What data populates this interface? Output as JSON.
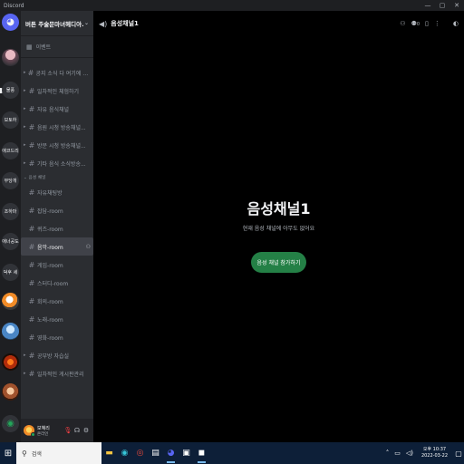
{
  "window": {
    "title": "Discord",
    "controls": {
      "minimize": "—",
      "maximize": "▢",
      "close": "✕"
    }
  },
  "servers": [
    {
      "type": "home",
      "icon": "discord-logo-icon"
    },
    {
      "type": "avatar",
      "label": ""
    },
    {
      "type": "text",
      "label": "물풍"
    },
    {
      "type": "text",
      "label": "보토하"
    },
    {
      "type": "text",
      "label": "애코드리"
    },
    {
      "type": "text",
      "label": "무당개"
    },
    {
      "type": "text",
      "label": "조하마"
    },
    {
      "type": "text",
      "label": "애너공도"
    },
    {
      "type": "text",
      "label": "덕후 세"
    },
    {
      "type": "avatar",
      "label": ""
    },
    {
      "type": "avatar",
      "label": ""
    },
    {
      "type": "avatar",
      "label": ""
    },
    {
      "type": "avatar",
      "label": ""
    },
    {
      "type": "discover",
      "icon": "compass-icon"
    }
  ],
  "guild": {
    "name": "버튼 주술문마녀헤디아...",
    "event_label": "이벤트"
  },
  "channels_top": [
    {
      "name": "공지 소식 다 여기에 확인...",
      "type": "text"
    },
    {
      "name": "일차적인 체험하기",
      "type": "text"
    },
    {
      "name": "자유 음식채널",
      "type": "text"
    },
    {
      "name": "음원 시청 방송채널...",
      "type": "text"
    },
    {
      "name": "방문 시청 방송채널...",
      "type": "text"
    },
    {
      "name": "기타 음식 소식방송...",
      "type": "text"
    }
  ],
  "voice_category": "음성 채널",
  "channels_voice": [
    {
      "name": "자유채팅방",
      "active": false
    },
    {
      "name": "잡담-room",
      "active": false
    },
    {
      "name": "퀴즈-room",
      "active": false
    },
    {
      "name": "음악-room",
      "active": true
    },
    {
      "name": "게임-room",
      "active": false
    },
    {
      "name": "스터디-room",
      "active": false
    },
    {
      "name": "회의-room",
      "active": false
    },
    {
      "name": "노래-room",
      "active": false
    },
    {
      "name": "영화-room",
      "active": false
    },
    {
      "name": "공부방 자습실",
      "active": false
    },
    {
      "name": "일차적인 게시판관리",
      "active": false
    }
  ],
  "user": {
    "name": "보혜리",
    "status": "온라인"
  },
  "main": {
    "channel_name": "음성채널1",
    "heading": "음성채널1",
    "subtext": "현재 음성 채널에 아무도 없어요",
    "join_button": "음성 채널 참가하기",
    "member_count": "0"
  },
  "taskbar": {
    "search_placeholder": "검색",
    "apps": [
      "file-explorer-icon",
      "edge-icon",
      "chrome-icon",
      "store-icon",
      "discord-icon",
      "app-icon",
      "notepad-icon"
    ],
    "time": "오후 10:37",
    "date": "2022-03-22"
  },
  "colors": {
    "accent_green": "#248046",
    "blurple": "#5865f2",
    "muted_red": "#f23f43"
  }
}
